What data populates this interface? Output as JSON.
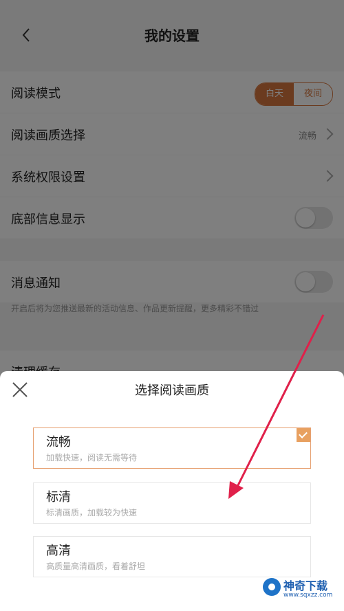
{
  "header": {
    "title": "我的设置",
    "back_icon": "chevron-left-icon"
  },
  "settings": {
    "reading_mode": {
      "label": "阅读模式",
      "options": [
        "白天",
        "夜间"
      ],
      "selected": "白天"
    },
    "reading_quality": {
      "label": "阅读画质选择",
      "value": "流畅"
    },
    "system_permissions": {
      "label": "系统权限设置"
    },
    "bottom_info": {
      "label": "底部信息显示"
    },
    "notifications": {
      "label": "消息通知",
      "desc": "开启后将为您推送最新的活动信息、作品更新提醒，更多精彩不错过"
    },
    "hidden_row": {
      "label": "清理缓存"
    }
  },
  "quality_sheet": {
    "title": "选择阅读画质",
    "options": [
      {
        "name": "流畅",
        "desc": "加载快速，阅读无需等待",
        "selected": true
      },
      {
        "name": "标清",
        "desc": "标清画质，加载较为快速",
        "selected": false
      },
      {
        "name": "高清",
        "desc": "高质量高清画质，看着舒坦",
        "selected": false
      }
    ]
  },
  "watermark": {
    "name": "神奇下载",
    "url": "www.sqxzz.com"
  },
  "colors": {
    "accent": "#d7773e",
    "arrow": "#e0204a",
    "overlay": "rgba(0,0,0,0.5)"
  }
}
